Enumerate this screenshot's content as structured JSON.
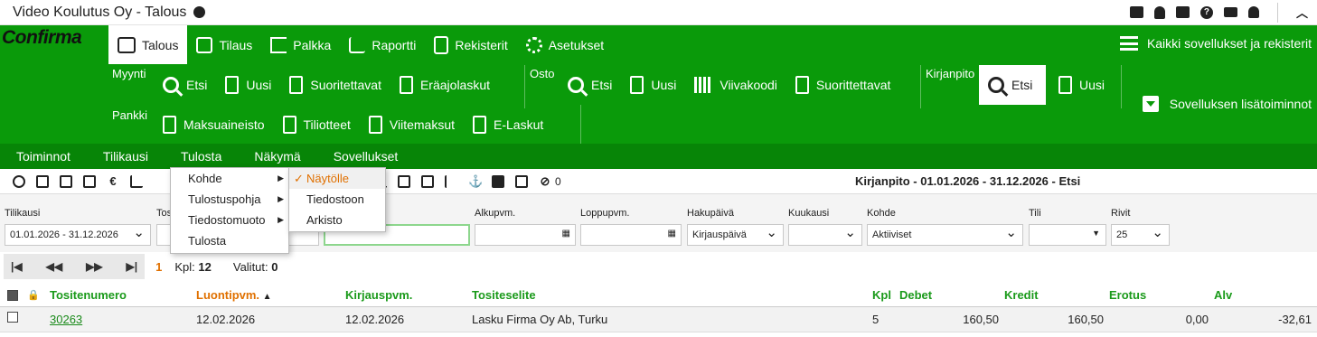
{
  "window": {
    "title": "Video Koulutus Oy - Talous"
  },
  "topicons": [
    "window-icon",
    "bell-icon",
    "book-icon",
    "help-icon",
    "mail-icon",
    "user-icon",
    "chevron-up-icon"
  ],
  "brand": {
    "logo": "Confirma"
  },
  "nav": {
    "tabs": [
      {
        "label": "Talous",
        "icon": "money-icon"
      },
      {
        "label": "Tilaus",
        "icon": "grid-icon"
      },
      {
        "label": "Palkka",
        "icon": "flag-icon"
      },
      {
        "label": "Raportti",
        "icon": "report-icon"
      },
      {
        "label": "Rekisterit",
        "icon": "register-icon"
      },
      {
        "label": "Asetukset",
        "icon": "gears-icon"
      }
    ],
    "all_apps": "Kaikki sovellukset ja rekisterit",
    "extra": "Sovelluksen lisätoiminnot"
  },
  "groups": {
    "myynti": {
      "label": "Myynti",
      "items": [
        "Etsi",
        "Uusi",
        "Suoritettavat",
        "Eräajolaskut"
      ]
    },
    "osto": {
      "label": "Osto",
      "items": [
        "Etsi",
        "Uusi",
        "Viivakoodi",
        "Suorittettavat"
      ]
    },
    "kirjanpito": {
      "label": "Kirjanpito",
      "items": [
        "Etsi",
        "Uusi"
      ]
    },
    "pankki": {
      "label": "Pankki",
      "items": [
        "Maksuaineisto",
        "Tiliotteet",
        "Viitemaksut",
        "E-Laskut"
      ]
    }
  },
  "menubar": [
    "Toiminnot",
    "Tilikausi",
    "Tulosta",
    "Näkymä",
    "Sovellukset"
  ],
  "toolbar": {
    "attachments": "0",
    "title": "Kirjanpito - 01.01.2026 - 31.12.2026 - Etsi"
  },
  "dropdown": {
    "items": [
      "Kohde",
      "Tulostuspohja",
      "Tiedostomuoto",
      "Tulosta"
    ],
    "submenu": [
      "Näytölle",
      "Tiedostoon",
      "Arkisto"
    ],
    "selected": "Näytölle"
  },
  "filters": {
    "tilikausi": {
      "label": "Tilikausi",
      "value": "01.01.2026 - 31.12.2026"
    },
    "tosite": {
      "label": "Tos"
    },
    "alkupvm": {
      "label": "Alkupvm."
    },
    "loppupvm": {
      "label": "Loppupvm."
    },
    "hakupaiva": {
      "label": "Hakupäivä",
      "value": "Kirjauspäivä"
    },
    "kuukausi": {
      "label": "Kuukausi"
    },
    "kohde": {
      "label": "Kohde",
      "value": "Aktiiviset"
    },
    "tili": {
      "label": "Tili"
    },
    "rivit": {
      "label": "Rivit",
      "value": "25"
    }
  },
  "pager": {
    "page": "1",
    "kpl_label": "Kpl:",
    "kpl": "12",
    "valitut_label": "Valitut:",
    "valitut": "0"
  },
  "table": {
    "columns": [
      "Tositenumero",
      "Luontipvm.",
      "Kirjauspvm.",
      "Tositeselite",
      "Kpl",
      "Debet",
      "Kredit",
      "Erotus",
      "Alv"
    ],
    "rows": [
      {
        "tositenumero": "30263",
        "luontipvm": "12.02.2026",
        "kirjauspvm": "12.02.2026",
        "tositeselite": "Lasku Firma Oy Ab, Turku",
        "kpl": "5",
        "debet": "160,50",
        "kredit": "160,50",
        "erotus": "0,00",
        "alv": "-32,61"
      }
    ]
  }
}
